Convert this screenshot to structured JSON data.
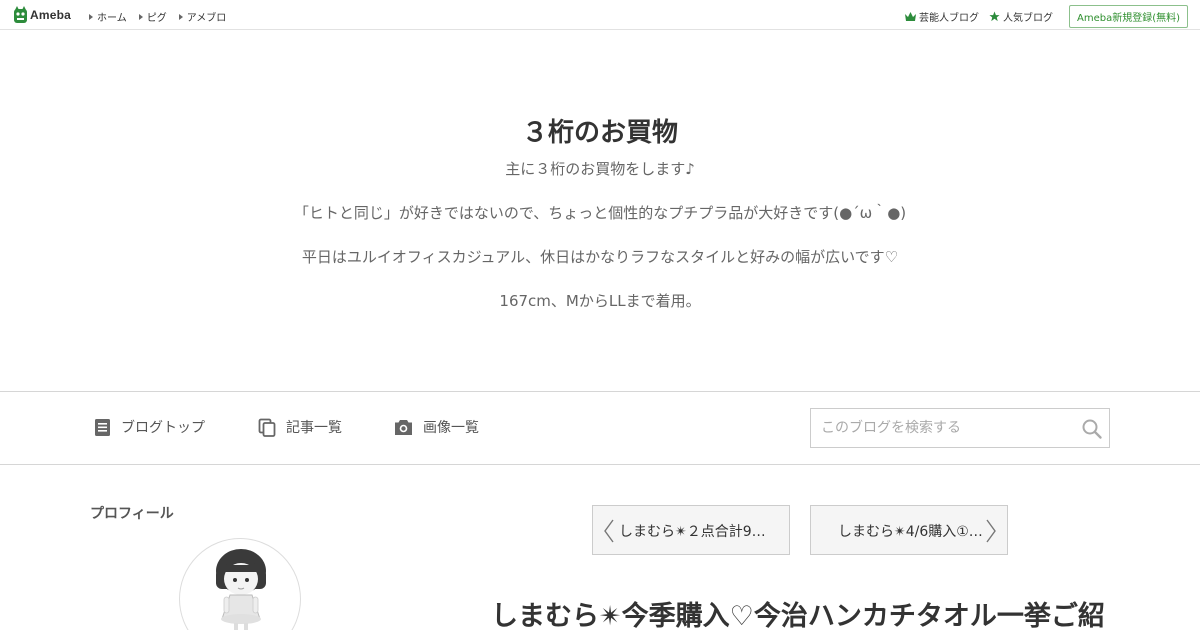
{
  "topbar": {
    "logo_text": "Ameba",
    "nav": [
      {
        "label": "ホーム"
      },
      {
        "label": "ピグ"
      },
      {
        "label": "アメブロ"
      }
    ],
    "right_links": [
      {
        "label": "芸能人ブログ",
        "icon": "crown-icon"
      },
      {
        "label": "人気ブログ",
        "icon": "star-icon"
      }
    ],
    "signup_label": "Ameba新規登録(無料)"
  },
  "header": {
    "title": "３桁のお買物",
    "description": [
      "主に３桁のお買物をします♪",
      "「ヒトと同じ」が好きではないので、ちょっと個性的なプチプラ品が大好きです(●´ω｀●)",
      "平日はユルイオフィスカジュアル、休日はかなりラフなスタイルと好みの幅が広いです♡",
      "167cm、MからLLまで着用。"
    ]
  },
  "blog_nav": {
    "items": [
      {
        "label": "ブログトップ",
        "icon": "document-icon"
      },
      {
        "label": "記事一覧",
        "icon": "copy-icon"
      },
      {
        "label": "画像一覧",
        "icon": "camera-icon"
      }
    ],
    "search_placeholder": "このブログを検索する"
  },
  "sidebar": {
    "profile_title": "プロフィール"
  },
  "pager": {
    "prev_label": "しまむら✴２点合計9…",
    "next_label": "しまむら✴4/6購入①…"
  },
  "entry": {
    "title": "しまむら✴今季購入♡今治ハンカチタオル一挙ご紹"
  },
  "colors": {
    "brand_green": "#2d8c3c",
    "text_main": "#333333",
    "text_sub": "#666666"
  }
}
